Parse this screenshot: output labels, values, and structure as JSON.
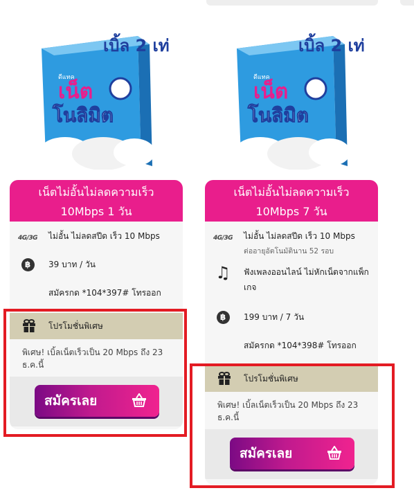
{
  "packages": [
    {
      "badge_text": "เบิ้ล 2 เท่า",
      "brand": "ดีแทค",
      "box_title_1": "เน็ต",
      "box_title_2": "โนลิมิต",
      "header_line1": "เน็ตไม่อั้นไม่ลดความเร็ว",
      "header_line2": "10Mbps 1 วัน",
      "feature_speed": "ไม่อั้น ไม่ลดสปีด เร็ว 10 Mbps",
      "feature_price": "39 บาท / วัน",
      "feature_dial": "สมัครกด *104*397# โทรออก",
      "promo_label": "โปรโมชั่นพิเศษ",
      "promo_detail": "พิเศษ! เบิ้ลเน็ตเร็วเป็น 20 Mbps ถึง 23 ธ.ค.นี้",
      "cta_label": "สมัครเลย"
    },
    {
      "badge_text": "เบิ้ล 2 เท่า",
      "brand": "ดีแทค",
      "box_title_1": "เน็ต",
      "box_title_2": "โนลิมิต",
      "header_line1": "เน็ตไม่อั้นไม่ลดความเร็ว",
      "header_line2": "10Mbps 7 วัน",
      "feature_speed": "ไม่อั้น ไม่ลดสปีด เร็ว 10 Mbps",
      "feature_speed_sub": "ต่ออายุอัตโนมัตินาน 52 รอบ",
      "feature_music": "ฟังเพลงออนไลน์ ไม่หักเน็ตจากแพ็กเกจ",
      "feature_price": "199 บาท / 7 วัน",
      "feature_dial": "สมัครกด *104*398# โทรออก",
      "promo_label": "โปรโมชั่นพิเศษ",
      "promo_detail": "พิเศษ! เบิ้ลเน็ตเร็วเป็น 20 Mbps ถึง 23 ธ.ค.นี้",
      "cta_label": "สมัครเลย"
    }
  ],
  "icons": {
    "network": "4G/3G",
    "baht": "฿"
  },
  "colors": {
    "header_pink": "#e91e8c",
    "promo_bar": "#d3cdb2",
    "cta_start": "#7b0a84",
    "cta_end": "#f0238f",
    "highlight_red": "#e31b23",
    "box_blue": "#2e9be0"
  }
}
